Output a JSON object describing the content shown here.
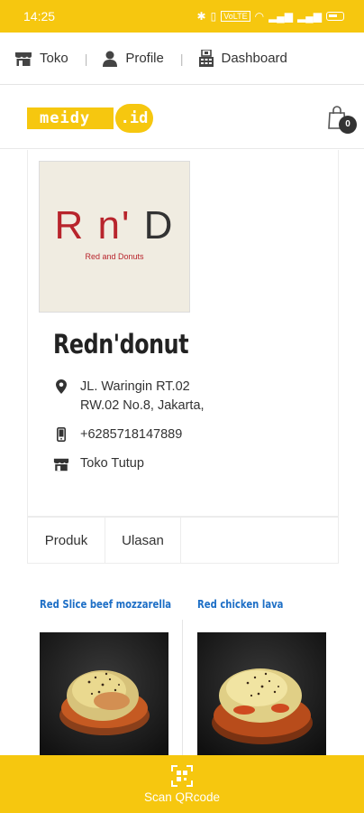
{
  "status_bar": {
    "time": "14:25",
    "icons": [
      "bluetooth-icon",
      "vibrate-icon",
      "volte-icon",
      "wifi-icon",
      "signal-icon",
      "signal-icon",
      "battery-icon"
    ]
  },
  "nav": {
    "items": [
      {
        "label": "Toko",
        "icon": "store-icon"
      },
      {
        "label": "Profile",
        "icon": "user-icon"
      },
      {
        "label": "Dashboard",
        "icon": "dashboard-icon"
      }
    ]
  },
  "header": {
    "logo_main": "meidy",
    "logo_suffix": ".id",
    "cart_count": "0"
  },
  "store": {
    "logo_text_part1": "R n'",
    "logo_text_part2": "D",
    "logo_subtext": "Red and Donuts",
    "name": "Redn'donut",
    "address_line1": "JL. Waringin RT.02",
    "address_line2": "RW.02 No.8, Jakarta,",
    "phone": "+6285718147889",
    "status": "Toko Tutup"
  },
  "tabs": [
    {
      "label": "Produk"
    },
    {
      "label": "Ulasan"
    }
  ],
  "products": [
    {
      "title": "Red Slice beef mozzarella"
    },
    {
      "title": "Red chicken lava"
    }
  ],
  "bottom_bar": {
    "label": "Scan QRcode",
    "icon": "qrcode-icon"
  },
  "colors": {
    "accent": "#f6c70f",
    "product_title": "#1e6fc6",
    "logo_red": "#b8242c"
  }
}
